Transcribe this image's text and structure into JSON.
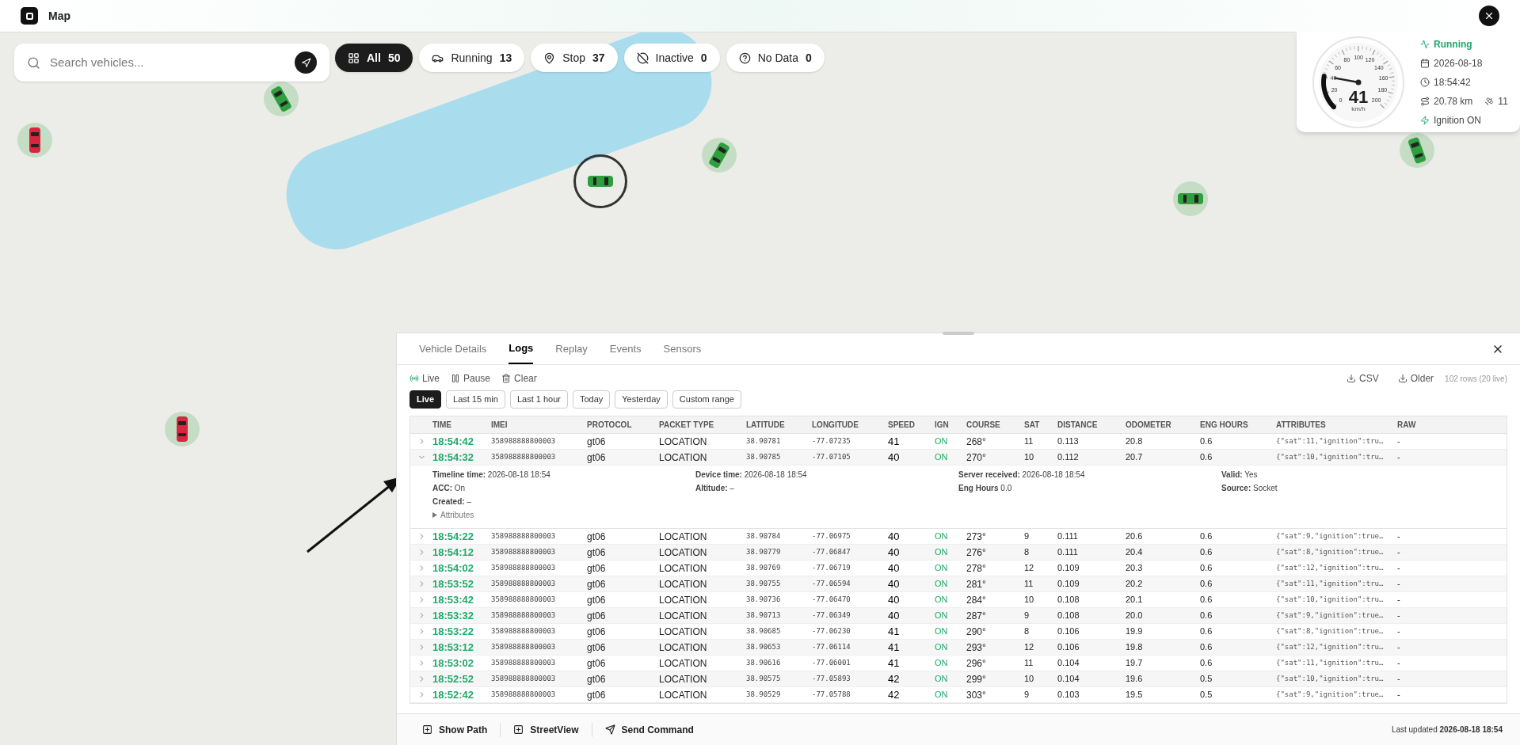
{
  "app_bar": {
    "title": "Map"
  },
  "search": {
    "placeholder": "Search vehicles..."
  },
  "status_filters": [
    {
      "kind": "all",
      "label": "All",
      "count": "50",
      "selected": true
    },
    {
      "kind": "running",
      "label": "Running",
      "count": "13",
      "selected": false
    },
    {
      "kind": "stop",
      "label": "Stop",
      "count": "37",
      "selected": false
    },
    {
      "kind": "inactive",
      "label": "Inactive",
      "count": "0",
      "selected": false
    },
    {
      "kind": "nodata",
      "label": "No Data",
      "count": "0",
      "selected": false
    }
  ],
  "vehicles": [
    {
      "color": "#d7263d",
      "selected": false
    },
    {
      "color": "#2e9e3e",
      "selected": false
    },
    {
      "color": "#2e9e3e",
      "selected": true
    },
    {
      "color": "#2e9e3e",
      "selected": false
    },
    {
      "color": "#2e9e3e",
      "selected": false
    },
    {
      "color": "#2e9e3e",
      "selected": false
    },
    {
      "color": "#d7263d",
      "selected": false
    }
  ],
  "speed_card": {
    "status": "Running",
    "date": "2026-08-18",
    "time": "18:54:42",
    "distance": "20.78 km",
    "satellites": "11",
    "ignition": "Ignition ON",
    "speed": "41",
    "unit": "km/h",
    "level": 0.205,
    "scale": [
      "0",
      "20",
      "40",
      "60",
      "80",
      "100",
      "120",
      "140",
      "160",
      "180",
      "200"
    ]
  },
  "panel": {
    "tabs": [
      {
        "label": "Vehicle Details",
        "selected": false
      },
      {
        "label": "Logs",
        "selected": true
      },
      {
        "label": "Replay",
        "selected": false
      },
      {
        "label": "Events",
        "selected": false
      },
      {
        "label": "Sensors",
        "selected": false
      }
    ],
    "toolbar": {
      "live": "Live",
      "pause": "Pause",
      "clear": "Clear",
      "csv": "CSV",
      "older": "Older",
      "row_count": "102 rows (20 live)"
    },
    "ranges": [
      {
        "label": "Live",
        "selected": true
      },
      {
        "label": "Last 15 min",
        "selected": false
      },
      {
        "label": "Last 1 hour",
        "selected": false
      },
      {
        "label": "Today",
        "selected": false
      },
      {
        "label": "Yesterday",
        "selected": false
      },
      {
        "label": "Custom range",
        "selected": false
      }
    ],
    "table": {
      "columns": [
        "TIME",
        "IMEI",
        "PROTOCOL",
        "PACKET TYPE",
        "LATITUDE",
        "LONGITUDE",
        "SPEED",
        "IGN",
        "COURSE",
        "SAT",
        "DISTANCE",
        "ODOMETER",
        "ENG HOURS",
        "ATTRIBUTES",
        "RAW"
      ],
      "rows": [
        {
          "expanded": false,
          "cells": [
            "18:54:42",
            "358988888800003",
            "gt06",
            "LOCATION",
            "38.90781",
            "-77.07235",
            "41",
            "ON",
            "268°",
            "11",
            "0.113",
            "20.8",
            "0.6",
            "{\"sat\":11,\"ignition\":tru…",
            "-"
          ]
        },
        {
          "expanded": true,
          "cells": [
            "18:54:32",
            "358988888800003",
            "gt06",
            "LOCATION",
            "38.90785",
            "-77.07105",
            "40",
            "ON",
            "270°",
            "10",
            "0.112",
            "20.7",
            "0.6",
            "{\"sat\":10,\"ignition\":tru…",
            "-"
          ],
          "details": [
            [
              "**Timeline time:** 2026-08-18 18:54",
              "**ACC:** On",
              "**Created:** –"
            ],
            [
              "**Device time:** 2026-08-18 18:54",
              "**Altitude:** –"
            ],
            [
              "**Server received:** 2026-08-18 18:54",
              "**Eng Hours** 0.0"
            ],
            [
              "**Valid:** Yes",
              "**Source:** Socket"
            ]
          ],
          "attributes_toggle": "Attributes"
        },
        {
          "expanded": false,
          "cells": [
            "18:54:22",
            "358988888800003",
            "gt06",
            "LOCATION",
            "38.90784",
            "-77.06975",
            "40",
            "ON",
            "273°",
            "9",
            "0.111",
            "20.6",
            "0.6",
            "{\"sat\":9,\"ignition\":true…",
            "-"
          ]
        },
        {
          "expanded": false,
          "cells": [
            "18:54:12",
            "358988888800003",
            "gt06",
            "LOCATION",
            "38.90779",
            "-77.06847",
            "40",
            "ON",
            "276°",
            "8",
            "0.111",
            "20.4",
            "0.6",
            "{\"sat\":8,\"ignition\":true…",
            "-"
          ]
        },
        {
          "expanded": false,
          "cells": [
            "18:54:02",
            "358988888800003",
            "gt06",
            "LOCATION",
            "38.90769",
            "-77.06719",
            "40",
            "ON",
            "278°",
            "12",
            "0.109",
            "20.3",
            "0.6",
            "{\"sat\":12,\"ignition\":tru…",
            "-"
          ]
        },
        {
          "expanded": false,
          "cells": [
            "18:53:52",
            "358988888800003",
            "gt06",
            "LOCATION",
            "38.90755",
            "-77.06594",
            "40",
            "ON",
            "281°",
            "11",
            "0.109",
            "20.2",
            "0.6",
            "{\"sat\":11,\"ignition\":tru…",
            "-"
          ]
        },
        {
          "expanded": false,
          "cells": [
            "18:53:42",
            "358988888800003",
            "gt06",
            "LOCATION",
            "38.90736",
            "-77.06470",
            "40",
            "ON",
            "284°",
            "10",
            "0.108",
            "20.1",
            "0.6",
            "{\"sat\":10,\"ignition\":tru…",
            "-"
          ]
        },
        {
          "expanded": false,
          "cells": [
            "18:53:32",
            "358988888800003",
            "gt06",
            "LOCATION",
            "38.90713",
            "-77.06349",
            "40",
            "ON",
            "287°",
            "9",
            "0.108",
            "20.0",
            "0.6",
            "{\"sat\":9,\"ignition\":true…",
            "-"
          ]
        },
        {
          "expanded": false,
          "cells": [
            "18:53:22",
            "358988888800003",
            "gt06",
            "LOCATION",
            "38.90685",
            "-77.06230",
            "41",
            "ON",
            "290°",
            "8",
            "0.106",
            "19.9",
            "0.6",
            "{\"sat\":8,\"ignition\":true…",
            "-"
          ]
        },
        {
          "expanded": false,
          "cells": [
            "18:53:12",
            "358988888800003",
            "gt06",
            "LOCATION",
            "38.90653",
            "-77.06114",
            "41",
            "ON",
            "293°",
            "12",
            "0.106",
            "19.8",
            "0.6",
            "{\"sat\":12,\"ignition\":tru…",
            "-"
          ]
        },
        {
          "expanded": false,
          "cells": [
            "18:53:02",
            "358988888800003",
            "gt06",
            "LOCATION",
            "38.90616",
            "-77.06001",
            "41",
            "ON",
            "296°",
            "11",
            "0.104",
            "19.7",
            "0.6",
            "{\"sat\":11,\"ignition\":tru…",
            "-"
          ]
        },
        {
          "expanded": false,
          "cells": [
            "18:52:52",
            "358988888800003",
            "gt06",
            "LOCATION",
            "38.90575",
            "-77.05893",
            "42",
            "ON",
            "299°",
            "10",
            "0.104",
            "19.6",
            "0.5",
            "{\"sat\":10,\"ignition\":tru…",
            "-"
          ]
        },
        {
          "expanded": false,
          "cells": [
            "18:52:42",
            "358988888800003",
            "gt06",
            "LOCATION",
            "38.90529",
            "-77.05788",
            "42",
            "ON",
            "303°",
            "9",
            "0.103",
            "19.5",
            "0.5",
            "{\"sat\":9,\"ignition\":true…",
            "-"
          ]
        }
      ]
    },
    "footer": {
      "buttons": [
        {
          "kind": "plus",
          "label": "Show Path"
        },
        {
          "kind": "plus",
          "label": "StreetView"
        },
        {
          "kind": "send",
          "label": "Send Command"
        }
      ],
      "last_updated": "Last updated **2026-08-18 18:54**"
    }
  }
}
